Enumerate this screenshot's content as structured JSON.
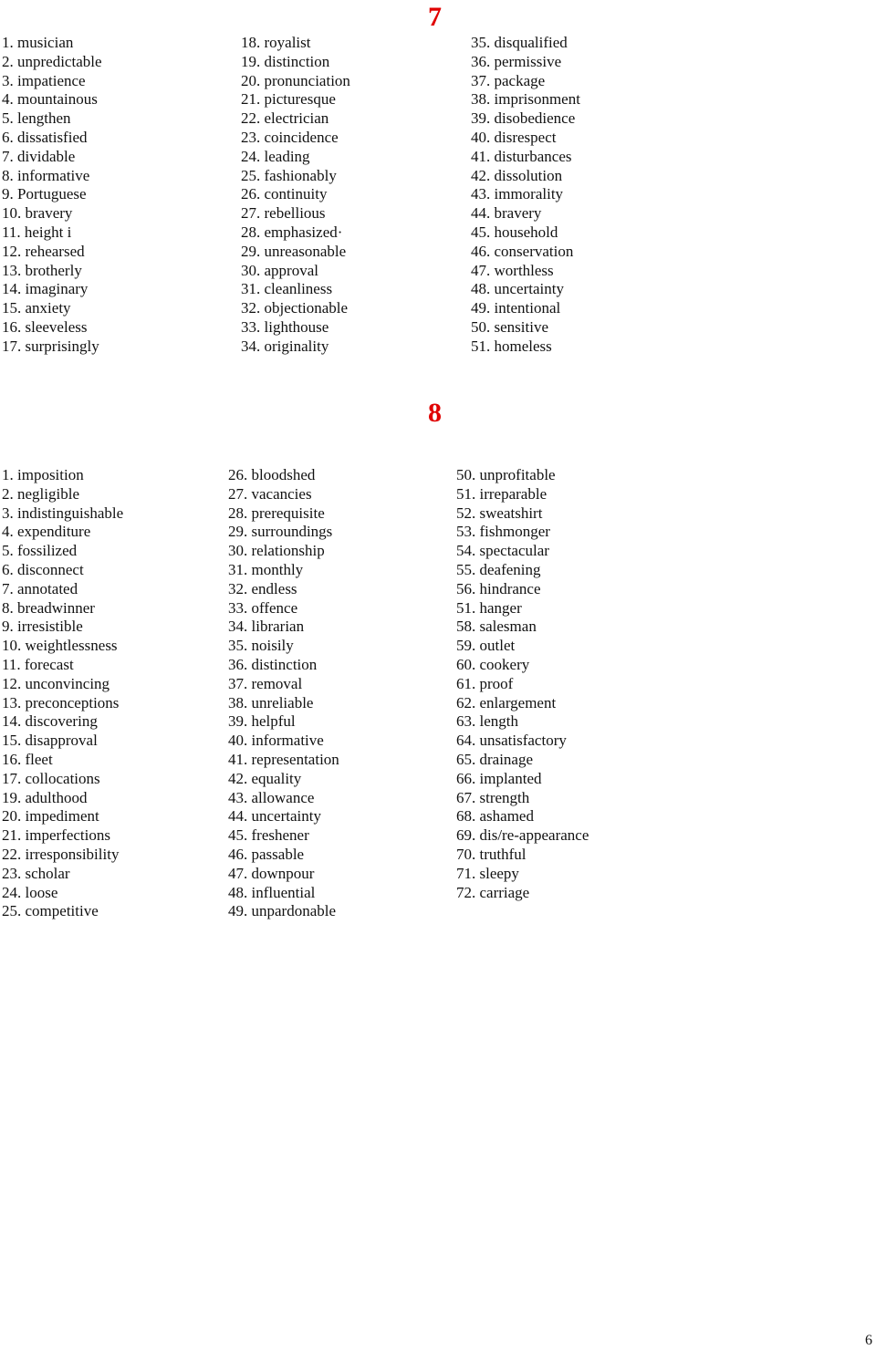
{
  "section7": {
    "heading": "7",
    "columns": [
      [
        "1. musician",
        "2. unpredictable",
        "3. impatience",
        "4. mountainous",
        "5. lengthen",
        "6. dissatisfied",
        "7. dividable",
        "8. informative",
        "9. Portuguese",
        "10. bravery",
        "11. height i",
        "12. rehearsed",
        "13. brotherly",
        "14. imaginary",
        "15. anxiety",
        "16. sleeveless",
        "17. surprisingly"
      ],
      [
        "18. royalist",
        "19. distinction",
        "20. pronunciation",
        "21. picturesque",
        "22. electrician",
        "23. coincidence",
        "24. leading",
        "25. fashionably",
        "26. continuity",
        "27. rebellious",
        "28. emphasized·",
        "29. unreasonable",
        "30. approval",
        "31. cleanliness",
        "32. objectionable",
        "33. lighthouse",
        "34. originality"
      ],
      [
        "35. disqualified",
        "36. permissive",
        "37. package",
        "38. imprisonment",
        "39. disobedience",
        "40. disrespect",
        "41. disturbances",
        "42. dissolution",
        "43. immorality",
        "44. bravery",
        "45. household",
        "46. conservation",
        "47. worthless",
        "48. uncertainty",
        "49. intentional",
        "50. sensitive",
        "51. homeless"
      ]
    ]
  },
  "section8": {
    "heading": "8",
    "columns": [
      [
        "1. imposition",
        "2. negligible",
        "3. indistinguishable",
        "4. expenditure",
        "5. fossilized",
        "6. disconnect",
        "7. annotated",
        "8. breadwinner",
        "9. irresistible",
        "10. weightlessness",
        "11. forecast",
        "12. unconvincing",
        "13. preconceptions",
        "14. discovering",
        "15. disapproval",
        "16. fleet",
        "17. collocations",
        "19. adulthood",
        "20. impediment",
        "21. imperfections",
        "22. irresponsibility",
        "23. scholar",
        "24. loose",
        "25. competitive"
      ],
      [
        "26. bloodshed",
        "27. vacancies",
        "28. prerequisite",
        "29. surroundings",
        "30. relationship",
        "31. monthly",
        "32. endless",
        "33. offence",
        "34. librarian",
        "35. noisily",
        "36. distinction",
        "37. removal",
        "38. unreliable",
        "39. helpful",
        "40. informative",
        "41. representation",
        "42. equality",
        "43. allowance",
        "44. uncertainty",
        "45. freshener",
        "46. passable",
        "47. downpour",
        "48. influential",
        "49. unpardonable"
      ],
      [
        "50. unprofitable",
        "51. irreparable",
        "52. sweatshirt",
        "53. fishmonger",
        "54. spectacular",
        "55. deafening",
        "56. hindrance",
        "51. hanger",
        "58. salesman",
        "59. outlet",
        "60. cookery",
        "61. proof",
        "62. enlargement",
        "63. length",
        "64. unsatisfactory",
        "65. drainage",
        "66. implanted",
        "67. strength",
        "68. ashamed",
        "69. dis/re-appearance",
        "70. truthful",
        "71. sleepy",
        "72. carriage"
      ]
    ]
  },
  "page_number": "6"
}
